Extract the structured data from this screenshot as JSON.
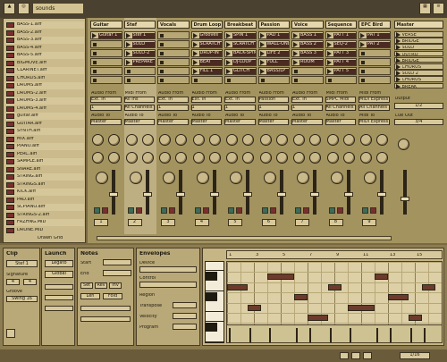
{
  "colors": {
    "bg": "#7a6a44",
    "panel": "#b9a878",
    "dark": "#3a3222",
    "accent": "#7a2e2e"
  },
  "browser": {
    "title": "sounds",
    "files": [
      "BASS-1.aiff",
      "BASS-2.aiff",
      "BASS-3.aiff",
      "BASS-4.aiff",
      "BASS-5.aiff",
      "BIGMOVE.aiff",
      "CLARINET.aiff",
      "CHORDS.aiff",
      "DRUMS.aiff",
      "DRUMS-2.aiff",
      "DRUMS-3.aiff",
      "DRUMS-4.aiff",
      "guitar.aiff",
      "GUITAR.aiff",
      "SYNTH.aiff",
      "MIX.aiff",
      "PIANO.aiff",
      "PERC.aiff",
      "SAMPLE.aiff",
      "SNARE.aiff",
      "STRING.aiff",
      "STRINGS.aiff",
      "KICK.aiff",
      "PAD.aiff",
      "SCPIANO.aiff",
      "STRINGS-2.aiff",
      "FRZHNG.MID",
      "DRONE.MID"
    ],
    "footer": "Drawn Grid"
  },
  "tracks": [
    {
      "name": "Guitar",
      "clips": [
        "Guitar 1",
        "",
        "",
        "",
        "",
        ""
      ],
      "input_hdr": "Audio From",
      "input": "Ext. In",
      "ch": "1",
      "monitor": "Audio To",
      "out": "Master",
      "num": "1"
    },
    {
      "name": "Stef",
      "clips": [
        "Stef 1",
        "SOLO",
        "SOLO-2",
        "PREPARE",
        "",
        ""
      ],
      "input_hdr": "Midi From",
      "input": "All Ins",
      "ch": "All Channels",
      "monitor": "Audio To",
      "out": "Master",
      "num": "2"
    },
    {
      "name": "Vocals",
      "clips": [
        "",
        "",
        "",
        "",
        "",
        ""
      ],
      "input_hdr": "Audio From",
      "input": "Ext. In",
      "ch": "1",
      "monitor": "Audio To",
      "out": "Master",
      "num": "3"
    },
    {
      "name": "Drum Loop",
      "clips": [
        "Grooves",
        "SCRATCH",
        "DROP-IN",
        "BEAT",
        "FILL 1",
        ""
      ],
      "input_hdr": "Audio From",
      "input": "Ext. In",
      "ch": "1",
      "monitor": "Audio To",
      "out": "Master",
      "num": "4"
    },
    {
      "name": "Breakbeat",
      "clips": [
        "SPIN 1",
        "SCRATCH",
        "BACK-SPIN",
        "DJ-LOOP",
        "GLITCH",
        ""
      ],
      "input_hdr": "Audio From",
      "input": "Ext. In",
      "ch": "1",
      "monitor": "Audio To",
      "out": "Master",
      "num": "5"
    },
    {
      "name": "Passion",
      "clips": [
        "PAD 1",
        "WALL-ONE",
        "LIFE 2",
        "FULL",
        "BASS/LP",
        ""
      ],
      "input_hdr": "Audio From",
      "input": "Passion",
      "ch": "1",
      "monitor": "Audio To",
      "out": "Master",
      "num": "6"
    },
    {
      "name": "Voice",
      "clips": [
        "BASS 1",
        "BASS 2",
        "BASS 3",
        "ROOM",
        "",
        ""
      ],
      "input_hdr": "Audio From",
      "input": "Ext. In",
      "ch": "1",
      "monitor": "Audio To",
      "out": "Master",
      "num": "7"
    },
    {
      "name": "Sequence",
      "clips": [
        "PATT 1",
        "SEQ-2",
        "PATT 3",
        "PATT 4",
        "PATT 5",
        ""
      ],
      "input_hdr": "Midi From",
      "input": "SMPC Midi",
      "ch": "All Channels",
      "monitor": "Audio To",
      "out": "Master",
      "num": "8"
    },
    {
      "name": "EPC Bird",
      "clips": [
        "PAT 1",
        "PAT 2",
        "",
        "",
        "",
        ""
      ],
      "input_hdr": "Midi From",
      "input": "MIDI Express",
      "ch": "All Channels",
      "monitor": "Midi To",
      "out": "MIDI Express",
      "num": "9"
    }
  ],
  "master": {
    "name": "Master",
    "scenes": [
      "VERSE",
      "BRIDGE",
      "SOLO",
      "OUTRO",
      "BRIDGE",
      "CHORUS",
      "SOLO 2",
      "CHORUS",
      "BREAK"
    ],
    "out_hdr": "Output",
    "out": "1/2",
    "cue": "Cue Out",
    "cue_val": "3/4"
  },
  "clip_panel": {
    "title": "Clip",
    "name": "Stef 1",
    "launch": "Launch",
    "legato": "Legato",
    "quant": "Global",
    "sig_num": "4",
    "sig_den": "4",
    "signature": "Signature",
    "groove": "Groove",
    "groove_val": "Swing 16"
  },
  "notes_panel": {
    "title": "Notes",
    "start": "Start",
    "end": "End",
    "set": "Set",
    "rev": "Rev",
    "inv": "Inv",
    "len": "Len",
    "fold": "Fold"
  },
  "envelope_panel": {
    "title": "Envelopes",
    "device": "Device",
    "control": "Control",
    "region": "Region",
    "transpose": "Transpose",
    "velocity": "Velocity",
    "program": "Program"
  },
  "piano_roll": {
    "bars": [
      "1",
      "3",
      "5",
      "7",
      "9",
      "11",
      "13",
      "15"
    ],
    "notes": [
      {
        "bar": 0,
        "row": 2,
        "len": 1.5
      },
      {
        "bar": 1.5,
        "row": 4,
        "len": 1
      },
      {
        "bar": 3,
        "row": 1,
        "len": 2
      },
      {
        "bar": 5,
        "row": 3,
        "len": 1
      },
      {
        "bar": 6,
        "row": 5,
        "len": 1.5
      },
      {
        "bar": 7.5,
        "row": 2,
        "len": 1
      },
      {
        "bar": 9,
        "row": 4,
        "len": 2
      },
      {
        "bar": 11,
        "row": 1,
        "len": 1
      },
      {
        "bar": 12,
        "row": 3,
        "len": 1.5
      },
      {
        "bar": 13.5,
        "row": 5,
        "len": 1
      },
      {
        "bar": 14.5,
        "row": 2,
        "len": 1
      }
    ]
  },
  "transport": {
    "tempo": "1/16"
  }
}
